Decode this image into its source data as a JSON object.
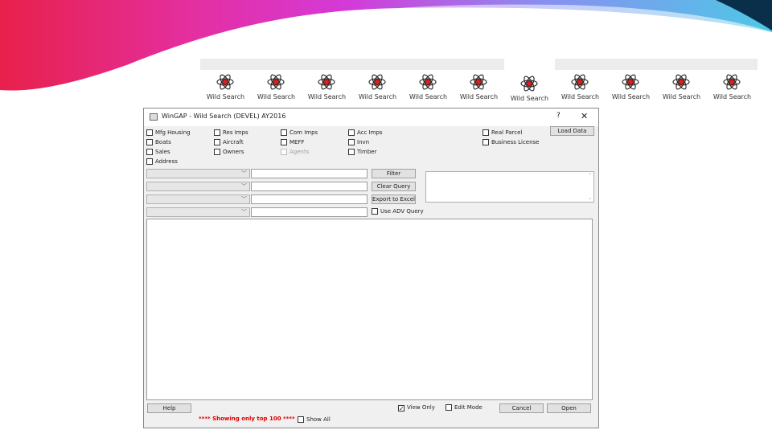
{
  "tiles": [
    {
      "label": "Wild Search",
      "selected": false
    },
    {
      "label": "Wild Search",
      "selected": false
    },
    {
      "label": "Wild Search",
      "selected": false
    },
    {
      "label": "Wild Search",
      "selected": false
    },
    {
      "label": "Wild Search",
      "selected": false
    },
    {
      "label": "Wild Search",
      "selected": false
    },
    {
      "label": "Wild Search",
      "selected": true
    },
    {
      "label": "Wild Search",
      "selected": false
    },
    {
      "label": "Wild Search",
      "selected": false
    },
    {
      "label": "Wild Search",
      "selected": false
    },
    {
      "label": "Wild Search",
      "selected": false
    }
  ],
  "window": {
    "title": "WinGAP - Wild Search (DEVEL) AY2016",
    "help_glyph": "?",
    "close_glyph": "✕"
  },
  "checkboxes": {
    "mfg_housing": "Mfg Housing",
    "boats": "Boats",
    "sales": "Sales",
    "address": "Address",
    "res_imps": "Res Imps",
    "aircraft": "Aircraft",
    "owners": "Owners",
    "com_imps": "Com Imps",
    "meff": "MEFF",
    "agents": "Agents",
    "acc_imps": "Acc Imps",
    "invn": "Invn",
    "timber": "Timber",
    "real_parcel": "Real Parcel",
    "business_license": "Business License",
    "use_adv_query": "Use ADV Query",
    "view_only": "View Only",
    "edit_mode": "Edit Mode",
    "show_all": "Show All"
  },
  "buttons": {
    "load_data": "Load Data",
    "filter": "Filter",
    "clear_query": "Clear Query",
    "export_excel": "Export to Excel",
    "help": "Help",
    "cancel": "Cancel",
    "open": "Open"
  },
  "status": "**** Showing only top 100 ****",
  "colors": {
    "arrow": "#e8203c",
    "status": "#e00000"
  }
}
